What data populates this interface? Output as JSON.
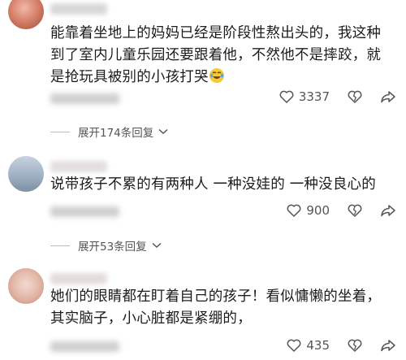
{
  "comments": [
    {
      "text_lines": [
        "能靠着坐地上的妈妈已经是阶段性熬出头的，我这种",
        "到了室内儿童乐园还要跟着他，不然他不是摔跤，就",
        "是抢玩具被别的小孩打哭"
      ],
      "emoji": "crying-laughing-emoji",
      "likes": "3337",
      "replies_label": "展开174条回复"
    },
    {
      "text_lines": [
        "说带孩子不累的有两种人 一种没娃的 一种没良心的"
      ],
      "likes": "900",
      "replies_label": "展开53条回复"
    },
    {
      "text_lines": [
        "她们的眼睛都在盯着自己的孩子！看似慵懒的坐着，",
        "其实脑子，小心脏都是紧绷的，"
      ],
      "likes": "435"
    }
  ],
  "colors": {
    "text": "#1c1c1c",
    "meta": "#555555",
    "blur": "#cfcfcf"
  }
}
